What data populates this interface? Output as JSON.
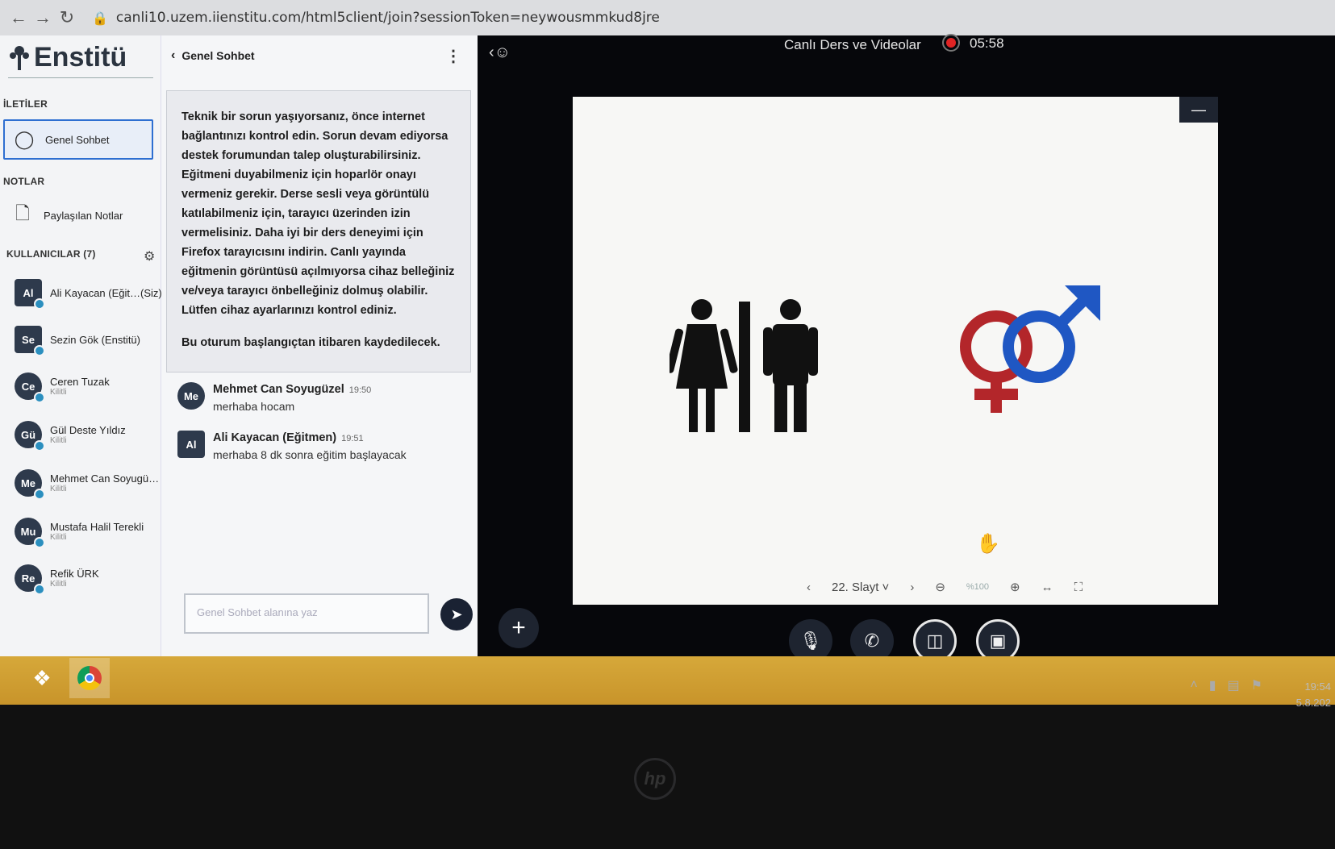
{
  "browser": {
    "url": "canli10.uzem.iienstitu.com/html5client/join?sessionToken=neywousmmkud8jre"
  },
  "leftnav": {
    "logo_text": "Enstitü",
    "sections": {
      "messages": "İLETİLER",
      "notes": "NOTLAR",
      "users": "KULLANICILAR (7)"
    },
    "public_chat_label": "Genel Sohbet",
    "shared_notes_label": "Paylaşılan Notlar",
    "users": [
      {
        "initials": "Al",
        "name": "Ali Kayacan (Eğit…(Siz)",
        "sub": ""
      },
      {
        "initials": "Se",
        "name": "Sezin Gök (Enstitü)",
        "sub": ""
      },
      {
        "initials": "Ce",
        "name": "Ceren Tuzak",
        "sub": "Kilitli"
      },
      {
        "initials": "Gü",
        "name": "Gül Deste Yıldız",
        "sub": "Kilitli"
      },
      {
        "initials": "Me",
        "name": "Mehmet Can Soyugü…",
        "sub": "Kilitli"
      },
      {
        "initials": "Mu",
        "name": "Mustafa Halil Terekli",
        "sub": "Kilitli"
      },
      {
        "initials": "Re",
        "name": "Refik ÜRK",
        "sub": "Kilitli"
      }
    ]
  },
  "chat": {
    "title": "Genel Sohbet",
    "welcome": "Teknik bir sorun yaşıyorsanız, önce internet bağlantınızı kontrol edin. Sorun devam ediyorsa destek forumundan talep oluşturabilirsiniz. Eğitmeni duyabilmeniz için hoparlör onayı vermeniz gerekir. Derse sesli veya görüntülü katılabilmeniz için, tarayıcı üzerinden izin vermelisiniz. Daha iyi bir ders deneyimi için Firefox tarayıcısını indirin. Canlı yayında eğitmenin görüntüsü açılmıyorsa cihaz belleğiniz ve/veya tarayıcı önbelleğiniz dolmuş olabilir. Lütfen cihaz ayarlarınızı kontrol ediniz.",
    "recording_notice": "Bu oturum başlangıçtan itibaren kaydedilecek.",
    "messages": [
      {
        "initials": "Me",
        "name": "Mehmet Can Soyugüzel",
        "time": "19:50",
        "text": "merhaba hocam"
      },
      {
        "initials": "Al",
        "name": "Ali Kayacan (Eğitmen)",
        "time": "19:51",
        "text": "merhaba 8 dk sonra eğitim başlayacak"
      }
    ],
    "input_placeholder": "Genel Sohbet alanına yaz"
  },
  "main": {
    "title": "Canlı Ders ve Videolar",
    "timer": "05:58",
    "slide_label": "22. Slayt",
    "zoom_label": "%100"
  },
  "icons": {
    "back": "chevron-left-icon",
    "forward": "arrow-right-icon",
    "reload": "reload-icon",
    "record": "record-icon"
  },
  "taskbar": {
    "clock_time": "19:54",
    "clock_date": "5.8.202"
  },
  "colors": {
    "accent_blue": "#2e6fd1",
    "record_red": "#e02424",
    "female_red": "#b3262a",
    "male_blue": "#1f57c3"
  }
}
